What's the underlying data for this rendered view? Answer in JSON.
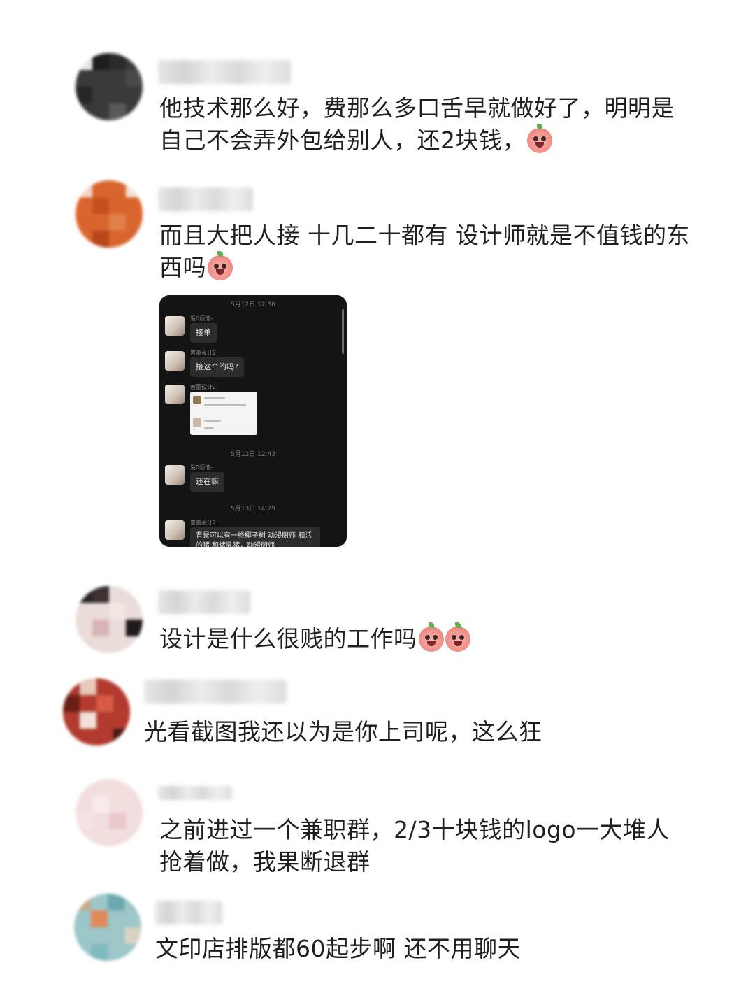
{
  "comments": [
    {
      "id": 1,
      "text": "他技术那么好，费那么多口舌早就做好了，明明是自己不会弄外包给别人，还2块钱，",
      "emoji": "crying-face-emoji"
    },
    {
      "id": 2,
      "text": "而且大把人接 十几二十都有 设计师就是不值钱的东西吗",
      "emoji": "shocked-face-emoji"
    },
    {
      "id": 3,
      "text": "设计是什么很贱的工作吗",
      "emoji": "crying-face-emoji"
    },
    {
      "id": 4,
      "text": "光看截图我还以为是你上司呢，这么狂"
    },
    {
      "id": 5,
      "text": "之前进过一个兼职群，2/3十块钱的logo一大堆人抢着做，我果断退群"
    },
    {
      "id": 6,
      "text": "文印店排版都60起步啊 还不用聊天"
    }
  ],
  "chat_screenshot": {
    "timestamps": [
      "5月12日 12:36",
      "5月12日 12:43",
      "5月13日 14:29"
    ],
    "messages": [
      {
        "sender": "没0烦恼-",
        "text": "接单"
      },
      {
        "sender": "普董设计2",
        "text": "接这个的吗?"
      },
      {
        "sender": "普董设计2",
        "text": ""
      },
      {
        "sender": "没0烦恼-",
        "text": "还在嘛"
      },
      {
        "sender": "普董设计2",
        "text": "背景可以有一些椰子树 动漫厨师 和活的猪 和烤乳猪，动漫厨师"
      }
    ]
  },
  "colors": {
    "background": "#ffffff",
    "text": "#1f1f1f",
    "chat_bg": "#141414",
    "bubble": "#2c2c2c"
  }
}
